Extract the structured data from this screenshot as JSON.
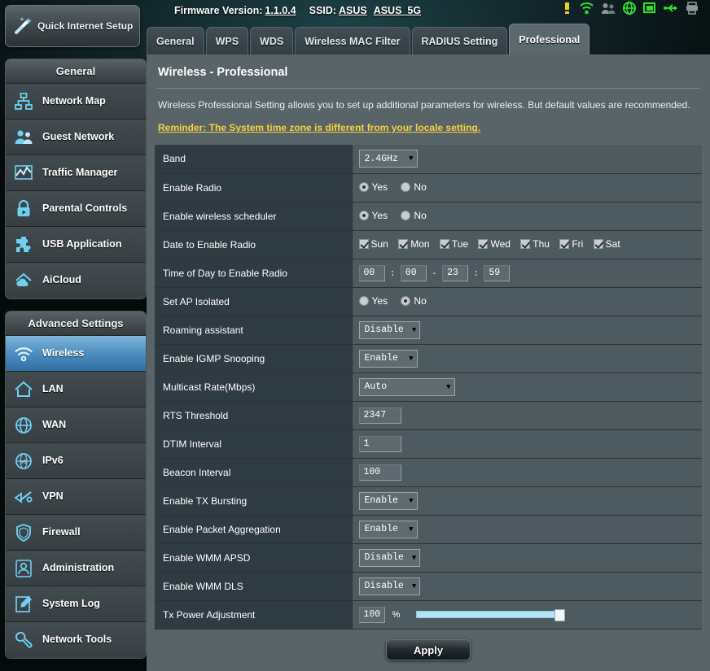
{
  "header": {
    "firmware_label": "Firmware Version:",
    "firmware_value": "1.1.0.4",
    "ssid_label": "SSID:",
    "ssid_24": "ASUS",
    "ssid_5g": "ASUS_5G",
    "tray_icons": [
      "alert-icon",
      "wifi-icon",
      "guest-network-icon",
      "internet-globe-icon",
      "monitor-icon",
      "usb-icon",
      "printer-icon"
    ]
  },
  "sidebar": {
    "quick_setup": "Quick Internet Setup",
    "general_header": "General",
    "general_items": [
      {
        "label": "Network Map",
        "icon": "network-map-icon"
      },
      {
        "label": "Guest Network",
        "icon": "guest-network-icon"
      },
      {
        "label": "Traffic Manager",
        "icon": "traffic-manager-icon"
      },
      {
        "label": "Parental Controls",
        "icon": "parental-controls-lock-icon"
      },
      {
        "label": "USB Application",
        "icon": "usb-application-puzzle-icon"
      },
      {
        "label": "AiCloud",
        "icon": "aicloud-icon"
      }
    ],
    "advanced_header": "Advanced Settings",
    "advanced_items": [
      {
        "label": "Wireless",
        "icon": "wireless-signal-icon",
        "active": true
      },
      {
        "label": "LAN",
        "icon": "lan-home-icon",
        "active": false
      },
      {
        "label": "WAN",
        "icon": "wan-globe-icon",
        "active": false
      },
      {
        "label": "IPv6",
        "icon": "ipv6-globe-icon",
        "active": false
      },
      {
        "label": "VPN",
        "icon": "vpn-key-icon",
        "active": false
      },
      {
        "label": "Firewall",
        "icon": "firewall-shield-icon",
        "active": false
      },
      {
        "label": "Administration",
        "icon": "administration-user-icon",
        "active": false
      },
      {
        "label": "System Log",
        "icon": "system-log-edit-icon",
        "active": false
      },
      {
        "label": "Network Tools",
        "icon": "network-tools-wrench-icon",
        "active": false
      }
    ]
  },
  "tabs": [
    {
      "label": "General",
      "active": false
    },
    {
      "label": "WPS",
      "active": false
    },
    {
      "label": "WDS",
      "active": false
    },
    {
      "label": "Wireless MAC Filter",
      "active": false
    },
    {
      "label": "RADIUS Setting",
      "active": false
    },
    {
      "label": "Professional",
      "active": true
    }
  ],
  "panel": {
    "title": "Wireless - Professional",
    "description": "Wireless Professional Setting allows you to set up additional parameters for wireless. But default values are recommended.",
    "reminder": "Reminder: The System time zone is different from your locale setting."
  },
  "settings": {
    "band": {
      "label": "Band",
      "value": "2.4GHz"
    },
    "enable_radio": {
      "label": "Enable Radio",
      "yes": "Yes",
      "no": "No",
      "selected": "Yes"
    },
    "wireless_scheduler": {
      "label": "Enable wireless scheduler",
      "yes": "Yes",
      "no": "No",
      "selected": "Yes"
    },
    "date_to_enable": {
      "label": "Date to Enable Radio",
      "days": [
        {
          "label": "Sun",
          "checked": true
        },
        {
          "label": "Mon",
          "checked": true
        },
        {
          "label": "Tue",
          "checked": true
        },
        {
          "label": "Wed",
          "checked": true
        },
        {
          "label": "Thu",
          "checked": true
        },
        {
          "label": "Fri",
          "checked": true
        },
        {
          "label": "Sat",
          "checked": true
        }
      ]
    },
    "time_of_day": {
      "label": "Time of Day to Enable Radio",
      "start_hour": "00",
      "start_min": "00",
      "end_hour": "23",
      "end_min": "59",
      "colon": ":",
      "dash": "-"
    },
    "ap_isolated": {
      "label": "Set AP Isolated",
      "yes": "Yes",
      "no": "No",
      "selected": "No"
    },
    "roaming_assistant": {
      "label": "Roaming assistant",
      "value": "Disable"
    },
    "igmp_snooping": {
      "label": "Enable IGMP Snooping",
      "value": "Enable"
    },
    "multicast_rate": {
      "label": "Multicast Rate(Mbps)",
      "value": "Auto"
    },
    "rts_threshold": {
      "label": "RTS Threshold",
      "value": "2347"
    },
    "dtim_interval": {
      "label": "DTIM Interval",
      "value": "1"
    },
    "beacon_interval": {
      "label": "Beacon Interval",
      "value": "100"
    },
    "tx_bursting": {
      "label": "Enable TX Bursting",
      "value": "Enable"
    },
    "packet_aggregation": {
      "label": "Enable Packet Aggregation",
      "value": "Enable"
    },
    "wmm_apsd": {
      "label": "Enable WMM APSD",
      "value": "Disable"
    },
    "wmm_dls": {
      "label": "Enable WMM DLS",
      "value": "Disable"
    },
    "tx_power": {
      "label": "Tx Power Adjustment",
      "value": "100",
      "unit": "%",
      "slider_percent": 100
    }
  },
  "apply_button": "Apply",
  "colors": {
    "accent_blue": "#4e8fc0",
    "reminder_yellow": "#f4d03f",
    "panel_bg": "#596468",
    "label_cell": "#2f3b42",
    "value_cell": "#4d5b61",
    "slider_fill": "#b6e2f5"
  }
}
